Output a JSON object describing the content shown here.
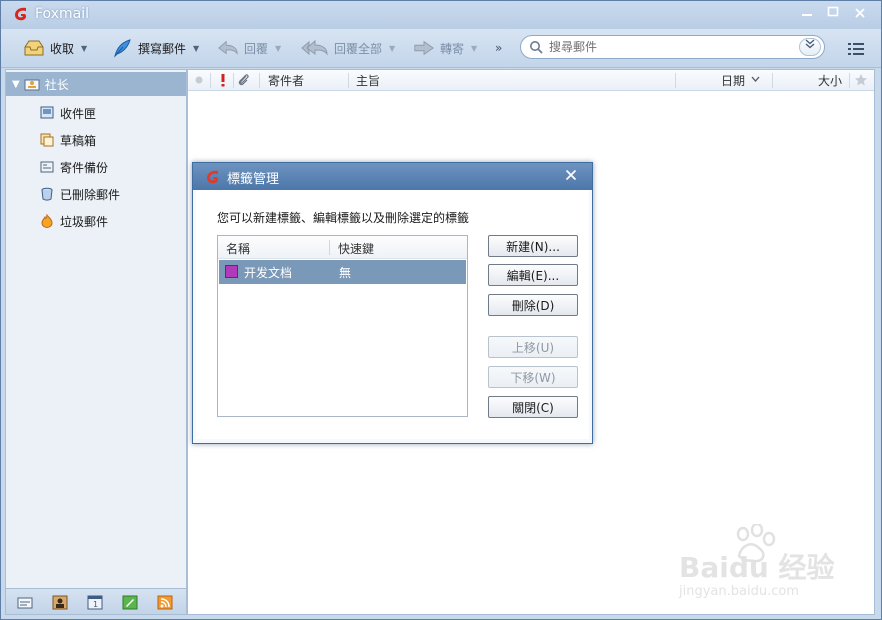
{
  "window": {
    "title": "Foxmail"
  },
  "toolbar": {
    "receive": "收取",
    "compose": "撰寫郵件",
    "reply": "回覆",
    "reply_all": "回覆全部",
    "forward": "轉寄",
    "more": "»",
    "search_placeholder": "搜尋郵件"
  },
  "sidebar": {
    "account": "社长",
    "folders": [
      {
        "label": "收件匣",
        "icon": "inbox-icon"
      },
      {
        "label": "草稿箱",
        "icon": "drafts-icon"
      },
      {
        "label": "寄件備份",
        "icon": "sent-icon"
      },
      {
        "label": "已刪除郵件",
        "icon": "trash-icon"
      },
      {
        "label": "垃圾郵件",
        "icon": "junk-icon"
      }
    ],
    "bottom_icons": [
      "mail-icon",
      "contacts-icon",
      "calendar-icon",
      "notes-icon",
      "rss-icon"
    ]
  },
  "mail_list": {
    "columns": {
      "sender": "寄件者",
      "subject": "主旨",
      "date": "日期",
      "size": "大小"
    }
  },
  "dialog": {
    "title": "標籤管理",
    "description": "您可以新建標籤、編輯標籤以及刪除選定的標籤",
    "columns": {
      "name": "名稱",
      "shortcut": "快速鍵"
    },
    "tags": [
      {
        "name": "开发文档",
        "shortcut": "無",
        "color": "#b03ab8"
      }
    ],
    "buttons": {
      "new": "新建(N)...",
      "edit": "編輯(E)...",
      "delete": "刪除(D)",
      "move_up": "上移(U)",
      "move_down": "下移(W)",
      "close": "關閉(C)"
    }
  },
  "watermark": {
    "main": "Baidu 经验",
    "sub": "jingyan.baidu.com"
  },
  "colors": {
    "accent": "#4d77a9",
    "selection": "#7a98b7",
    "logo_red": "#d9261c"
  }
}
